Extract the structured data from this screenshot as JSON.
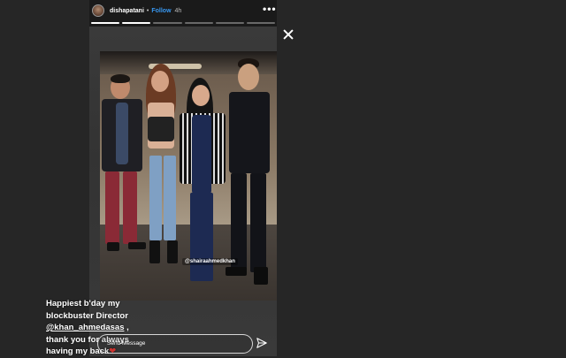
{
  "header": {
    "username": "dishapatani",
    "separator": "•",
    "follow_label": "Follow",
    "time": "4h",
    "more_icon": "•••"
  },
  "progress": {
    "segments_total": 6,
    "segments_done": 2
  },
  "story": {
    "photo_tag": "@shairaahmedkhan",
    "caption_line1": "Happiest b'day my",
    "caption_line2": "blockbuster Director",
    "caption_mention": "@khan_ahmedasas",
    "caption_line3_suffix": " ,",
    "caption_line4": "thank you for always",
    "caption_line5": "having my back",
    "caption_heart": "❤"
  },
  "reply": {
    "placeholder": "Send Message"
  },
  "icons": {
    "close": "close-icon",
    "send": "send-icon",
    "more": "more-options-icon"
  },
  "colors": {
    "background": "#262626",
    "follow": "#3897f0",
    "heart": "#e53935"
  }
}
